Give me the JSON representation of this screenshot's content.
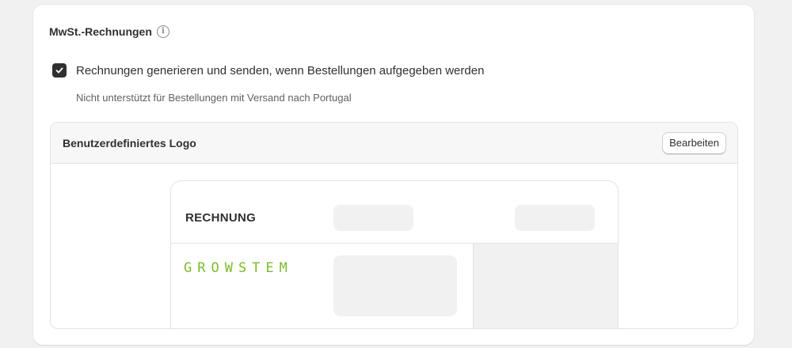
{
  "section": {
    "title": "MwSt.-Rechnungen",
    "info_icon": "info-icon"
  },
  "checkbox": {
    "checked": true,
    "label": "Rechnungen generieren und senden, wenn Bestellungen aufgegeben werden",
    "help_text": "Nicht unterstützt für Bestellungen mit Versand nach Portugal"
  },
  "custom_logo": {
    "title": "Benutzerdefiniertes Logo",
    "edit_label": "Bearbeiten"
  },
  "preview": {
    "invoice_title": "RECHNUNG",
    "logo_text": "GROWSTEM",
    "logo_color": "#7dbb2b"
  }
}
